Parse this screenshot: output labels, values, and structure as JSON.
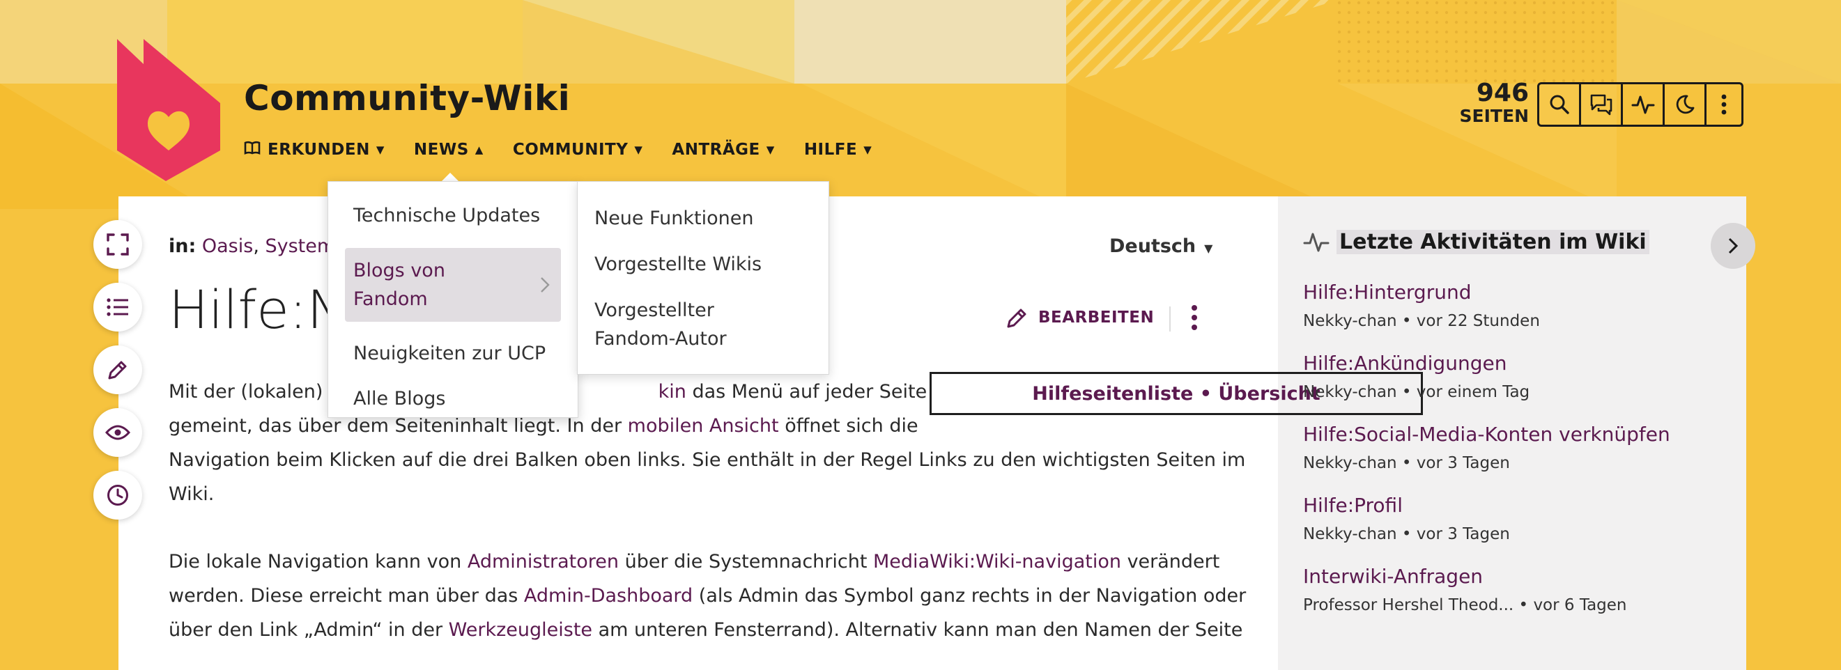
{
  "colors": {
    "header_bg": "#f6c33e",
    "link": "#5b1a4f",
    "logo": "#e8365d",
    "rail_bg": "#f2f1f1"
  },
  "header": {
    "wiki_name": "Community-Wiki",
    "nav": [
      {
        "label": "ERKUNDEN",
        "icon": "book-icon"
      },
      {
        "label": "NEWS"
      },
      {
        "label": "COMMUNITY"
      },
      {
        "label": "ANTRÄGE"
      },
      {
        "label": "HILFE"
      }
    ],
    "pages_count": "946",
    "pages_label": "SEITEN",
    "toolbar_icons": [
      "search-icon",
      "discussions-icon",
      "activity-icon",
      "dark-mode-icon",
      "more-icon"
    ]
  },
  "news_dropdown": {
    "items": [
      "Technische Updates",
      "Blogs von Fandom",
      "Neuigkeiten zur UCP",
      "Alle Blogs"
    ],
    "active": "Blogs von Fandom",
    "submenu": [
      "Neue Funktionen",
      "Vorgestellte Wikis",
      "Vorgestellter Fandom-Autor"
    ]
  },
  "page": {
    "breadcrumb_label": "in:",
    "breadcrumb_links": [
      "Oasis",
      "Systemn"
    ],
    "language": "Deutsch",
    "title": "Hilfe:Na",
    "edit_label": "BEARBEITEN",
    "infobox_label": "Hilfeseitenliste • Übersicht",
    "para1": {
      "l1a": "Mit der (lokalen) ",
      "l1b": "N",
      "l1c": "kin",
      "l1d": " das Menü auf jeder Seite",
      "l2a": "gemeint, das über dem Seiteninhalt liegt. In der ",
      "l2link": "mobilen Ansicht",
      "l2b": " öffnet sich die",
      "l3": "Navigation beim Klicken auf die drei Balken oben links. Sie enthält in der Regel Links zu den wichtigsten Seiten im",
      "l4": "Wiki."
    },
    "para2": {
      "l1a": "Die lokale Navigation kann von ",
      "l1link1": "Administratoren",
      "l1b": " über die Systemnachricht ",
      "l1link2": "MediaWiki:Wiki-navigation",
      "l1c": " verändert",
      "l2a": "werden. Diese erreicht man über das ",
      "l2link": "Admin-Dashboard",
      "l2b": " (als Admin das Symbol ganz rechts in der Navigation oder",
      "l3a": "über den Link „Admin“ in der ",
      "l3link": "Werkzeugleiste",
      "l3b": " am unteren Fensterrand). Alternativ kann man den Namen der Seite"
    }
  },
  "floating_tools": [
    "fullscreen-icon",
    "toc-icon",
    "edit-icon",
    "watch-icon",
    "history-icon"
  ],
  "rail": {
    "title": "Letzte Aktivitäten im Wiki",
    "items": [
      {
        "title": "Hilfe:Hintergrund",
        "user": "Nekky-chan",
        "time": "vor 22 Stunden"
      },
      {
        "title": "Hilfe:Ankündigungen",
        "user": "Nekky-chan",
        "time": "vor einem Tag"
      },
      {
        "title": "Hilfe:Social-Media-Konten verknüpfen",
        "user": "Nekky-chan",
        "time": "vor 3 Tagen"
      },
      {
        "title": "Hilfe:Profil",
        "user": "Nekky-chan",
        "time": "vor 3 Tagen"
      },
      {
        "title": "Interwiki-Anfragen",
        "user": "Professor Hershel Theod...",
        "time": "vor 6 Tagen"
      }
    ],
    "separator": "•"
  }
}
